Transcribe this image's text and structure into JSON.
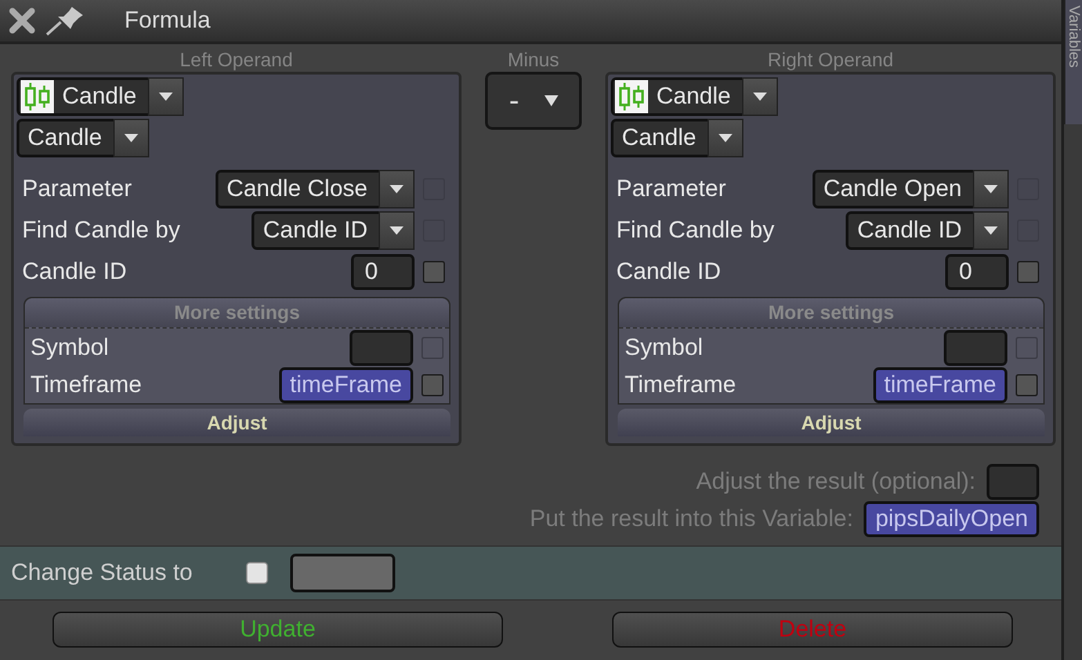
{
  "window": {
    "title": "Formula"
  },
  "side_tab": {
    "label": "Variables"
  },
  "operator": {
    "label": "Minus",
    "value": "-"
  },
  "operands": [
    {
      "label": "Left Operand",
      "source": "Candle",
      "type": "Candle",
      "rows": [
        {
          "label": "Parameter",
          "kind": "select",
          "value": "Candle Close",
          "box_disabled": true
        },
        {
          "label": "Find Candle by",
          "kind": "select",
          "value": "Candle ID",
          "box_disabled": true
        },
        {
          "label": "Candle ID",
          "kind": "input",
          "value": "0",
          "box_disabled": false
        }
      ],
      "more": {
        "title": "More settings",
        "rows": [
          {
            "label": "Symbol",
            "kind": "input",
            "box_disabled": true
          },
          {
            "label": "Timeframe",
            "kind": "variable",
            "value": "timeFrame",
            "box_disabled": false
          }
        ]
      },
      "adjust": "Adjust"
    },
    {
      "label": "Right Operand",
      "source": "Candle",
      "type": "Candle",
      "rows": [
        {
          "label": "Parameter",
          "kind": "select",
          "value": "Candle Open",
          "box_disabled": true
        },
        {
          "label": "Find Candle by",
          "kind": "select",
          "value": "Candle ID",
          "box_disabled": true
        },
        {
          "label": "Candle ID",
          "kind": "input",
          "value": "0",
          "box_disabled": false
        }
      ],
      "more": {
        "title": "More settings",
        "rows": [
          {
            "label": "Symbol",
            "kind": "input",
            "box_disabled": true
          },
          {
            "label": "Timeframe",
            "kind": "variable",
            "value": "timeFrame",
            "box_disabled": false
          }
        ]
      },
      "adjust": "Adjust"
    }
  ],
  "result": [
    {
      "label": "Adjust the result (optional):",
      "kind": "input"
    },
    {
      "label": "Put the result into this Variable:",
      "kind": "variable",
      "value": "pipsDailyOpen"
    }
  ],
  "status": {
    "label": "Change Status to",
    "checked": false
  },
  "buttons": [
    {
      "label": "Update",
      "color": "#40b030"
    },
    {
      "label": "Delete",
      "color": "#c00010"
    }
  ]
}
